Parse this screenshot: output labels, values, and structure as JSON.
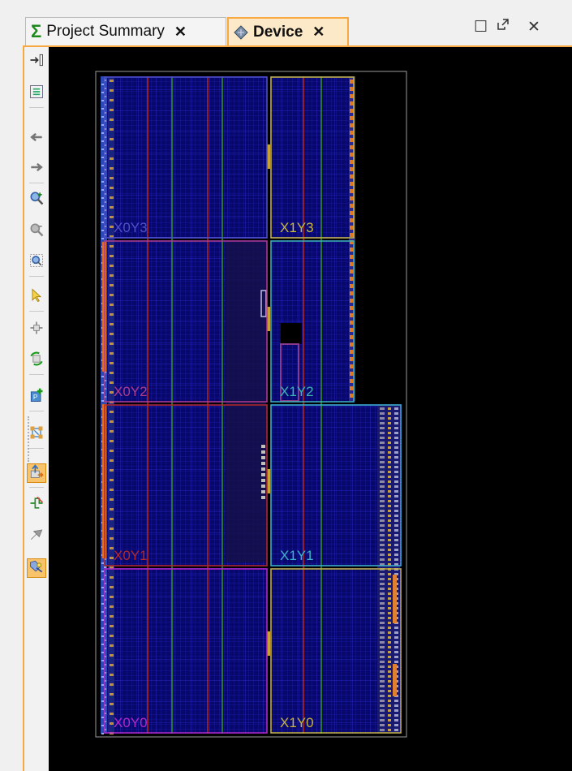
{
  "tabs": [
    {
      "label": "Project Summary",
      "active": false
    },
    {
      "label": "Device",
      "active": true
    }
  ],
  "window_controls": [
    "maximize-icon",
    "restore-icon",
    "close-icon"
  ],
  "toolbar": [
    "expand-panel-icon",
    "fit-selection-icon",
    "back-icon",
    "forward-icon",
    "zoom-in-icon",
    "zoom-out-icon",
    "zoom-fit-icon",
    "select-icon",
    "move-icon",
    "auto-route-icon",
    "add-pblock-icon",
    "show-nets-icon",
    "route-icon",
    "highlight-icon",
    "unplace-icon",
    "show-clock-regions-icon"
  ],
  "clock_regions": [
    {
      "name": "X0Y3",
      "color": "#5050c8"
    },
    {
      "name": "X1Y3",
      "color": "#c8b83c"
    },
    {
      "name": "X0Y2",
      "color": "#b03c8c"
    },
    {
      "name": "X1Y2",
      "color": "#3cb4b4"
    },
    {
      "name": "X0Y1",
      "color": "#b42828"
    },
    {
      "name": "X1Y1",
      "color": "#3cb4c8"
    },
    {
      "name": "X0Y0",
      "color": "#b428c8"
    },
    {
      "name": "X1Y0",
      "color": "#c8b43c"
    }
  ],
  "colors": {
    "accent": "#f7a940",
    "canvas": "#000000",
    "fabric": "#0a0a6e"
  }
}
